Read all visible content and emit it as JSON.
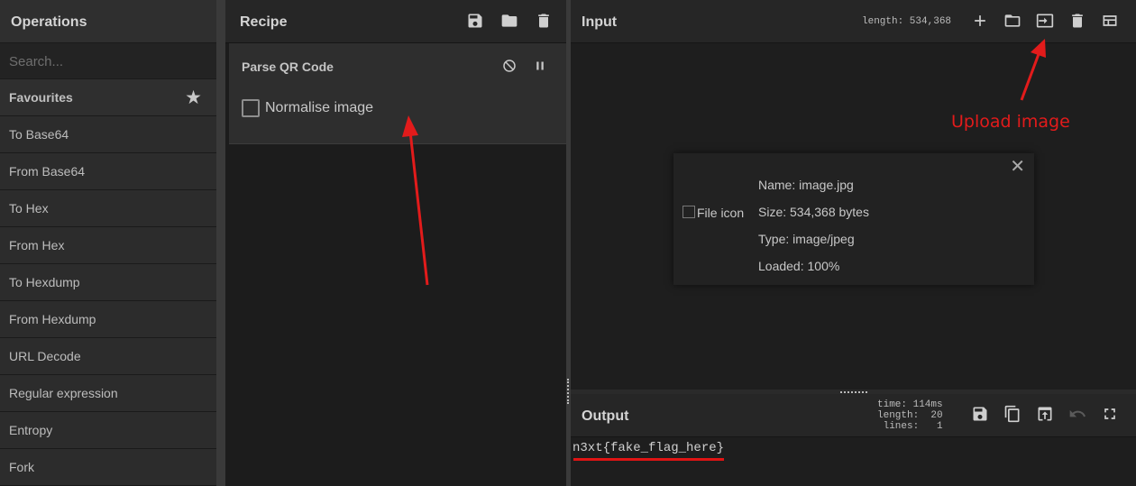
{
  "operations": {
    "title": "Operations",
    "search_placeholder": "Search...",
    "favourites_label": "Favourites",
    "items": [
      {
        "label": "To Base64"
      },
      {
        "label": "From Base64"
      },
      {
        "label": "To Hex"
      },
      {
        "label": "From Hex"
      },
      {
        "label": "To Hexdump"
      },
      {
        "label": "From Hexdump"
      },
      {
        "label": "URL Decode"
      },
      {
        "label": "Regular expression"
      },
      {
        "label": "Entropy"
      },
      {
        "label": "Fork"
      }
    ]
  },
  "recipe": {
    "title": "Recipe",
    "operation": {
      "name": "Parse QR Code",
      "checkbox_label": "Normalise image",
      "checked": false
    }
  },
  "input": {
    "title": "Input",
    "length_label": "length: 534,368",
    "file": {
      "icon_alt": "File icon",
      "name": "Name: image.jpg",
      "size": "Size: 534,368 bytes",
      "type": "Type: image/jpeg",
      "loaded": "Loaded: 100%"
    }
  },
  "annotation": {
    "upload_label": "Upload image",
    "color": "#e21b1b"
  },
  "output": {
    "title": "Output",
    "stats": "time: 114ms\nlength:  20\nlines:   1",
    "text": "n3xt{fake_flag_here}"
  }
}
